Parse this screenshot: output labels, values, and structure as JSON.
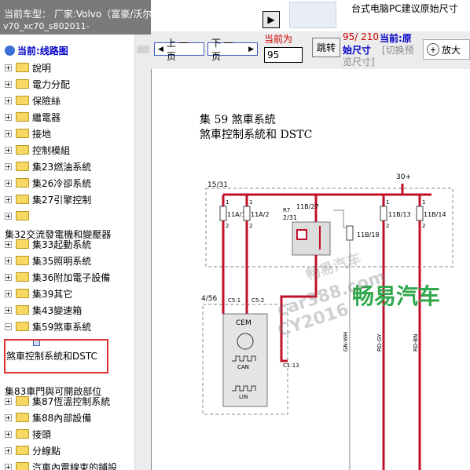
{
  "left_header": {
    "line1": "当前车型：  厂家:Volvo（富豪/沃尔沃）",
    "line2": "v70_xc70_s802011-"
  },
  "tree": {
    "root_label": "当前:线路图",
    "items": [
      {
        "label": "說明",
        "top": 0
      },
      {
        "label": "電力分配"
      },
      {
        "label": "保險絲"
      },
      {
        "label": "繼電器"
      },
      {
        "label": "接地"
      },
      {
        "label": "控制模組"
      },
      {
        "label": "集23燃油系統"
      },
      {
        "label": "集26冷卻系統"
      },
      {
        "label": "集27引擎控制"
      },
      {
        "label": ""
      }
    ],
    "group_32": "集32交流發電機和變壓器",
    "items2": [
      {
        "label": "集33起動系統"
      },
      {
        "label": "集35照明系統"
      },
      {
        "label": "集36附加電子設備"
      },
      {
        "label": "集39其它"
      },
      {
        "label": "集43變速箱"
      },
      {
        "label": "集59煞車系統"
      }
    ],
    "selected": "煞車控制系統和DSTC",
    "group_83": "集83車門與可開啟部位",
    "items3": [
      {
        "label": "集87恆溫控制系統"
      },
      {
        "label": "集88內部設備"
      },
      {
        "label": "接頭"
      },
      {
        "label": "分線點"
      },
      {
        "label": "汽車內電線束的鋪設"
      }
    ]
  },
  "toolbar": {
    "prev_label": "上 一 页",
    "next_label": "下 一 页",
    "current_label": "当前为",
    "page_value": "95",
    "jump_label": "跳转",
    "page_count": "95/ 210",
    "orig_size_a": "当前:原",
    "orig_size_b": "始尺寸",
    "switch_a": "[切换预",
    "switch_b": "览尺寸]",
    "zoom_label": "放大"
  },
  "banner": {
    "text": "台式电脑PC建议原始尺寸"
  },
  "diagram": {
    "title1": "集 59 煞車系統",
    "title2": "煞車控制系統和 DSTC",
    "fuse_box": "15/31",
    "supply": "30+",
    "fuses": [
      "11A/1",
      "11A/2",
      "11B/13",
      "11B/14"
    ],
    "relay_top": "11B/27",
    "relay_r7": "R7",
    "relay_231": "2/31",
    "fuse_11b18": "11B/18",
    "cem_box": "4/56",
    "connectors": [
      "C5:1",
      "C5:2",
      "C1:13"
    ],
    "cem": "CEM",
    "can": "CAN",
    "lin": "LIN",
    "wires": [
      "GN-WH",
      "RD-GY",
      "RD-BN"
    ],
    "pin_labels": [
      "1",
      "2"
    ],
    "watermarks": [
      "畅易汽车",
      "car388.com",
      "CY2016",
      "畅易汽车"
    ]
  },
  "colors": {
    "wire": "#c0102a",
    "selection_box": "#e23030",
    "watermark_green": "#2ea84a",
    "accent_blue": "#0000c8",
    "accent_red": "#d00000"
  }
}
